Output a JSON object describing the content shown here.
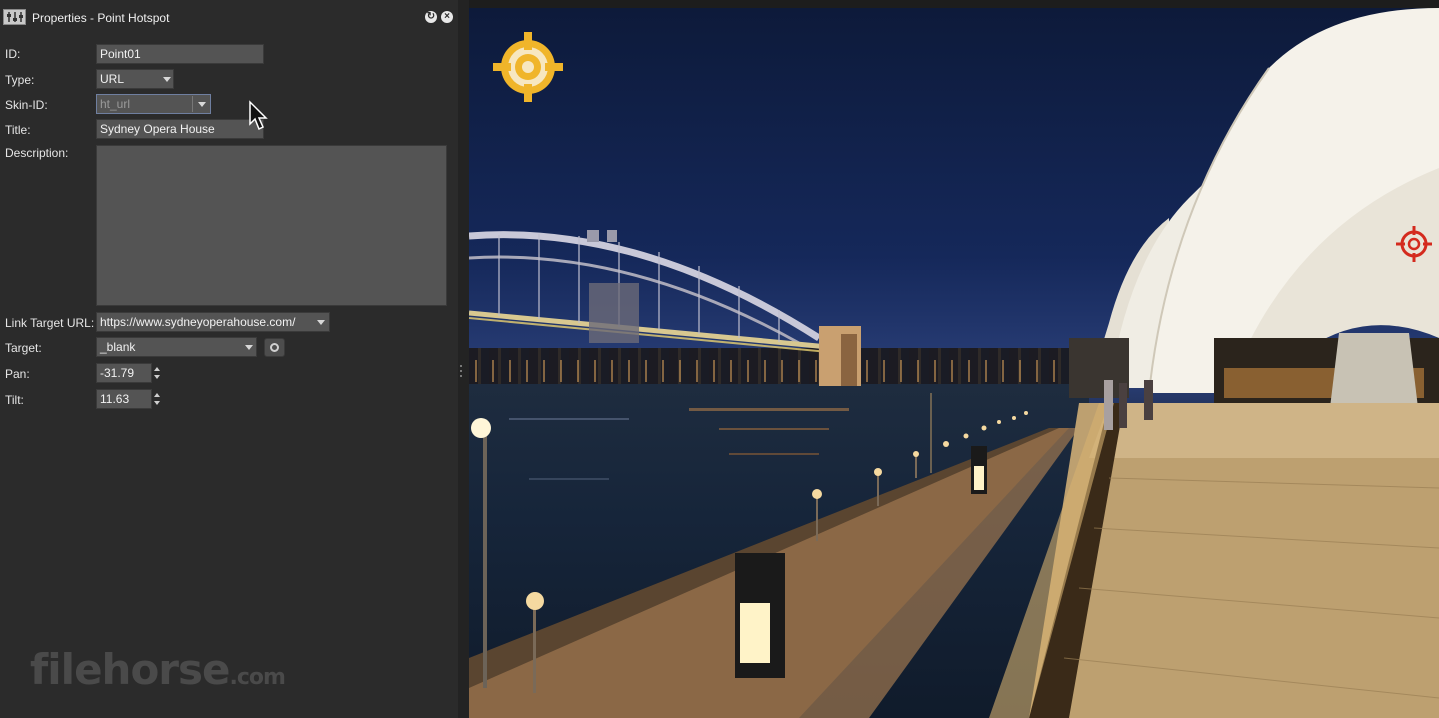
{
  "window": {
    "title": "Properties - Point Hotspot"
  },
  "form": {
    "id_label": "ID:",
    "id_value": "Point01",
    "type_label": "Type:",
    "type_value": "URL",
    "skin_label": "Skin-ID:",
    "skin_value": "ht_url",
    "title_label": "Title:",
    "title_value": "Sydney Opera House",
    "description_label": "Description:",
    "description_value": "",
    "url_label": "Link Target URL:",
    "url_value": "https://www.sydneyoperahouse.com/",
    "target_label": "Target:",
    "target_value": "_blank",
    "pan_label": "Pan:",
    "pan_value": "-31.79",
    "tilt_label": "Tilt:",
    "tilt_value": "11.63"
  },
  "watermark": {
    "brand": "filehorse",
    "tld": ".com"
  },
  "colors": {
    "panel_bg": "#2b2b2b",
    "field_bg": "#545454",
    "hotspot_yellow": "#f0b52a",
    "hotspot_red": "#d42a1e"
  },
  "icons": [
    "app-icon",
    "refresh-icon",
    "close-icon",
    "chevron-down-icon",
    "target-picker-icon",
    "spin-up-icon",
    "spin-down-icon",
    "hotspot-marker-icon"
  ]
}
